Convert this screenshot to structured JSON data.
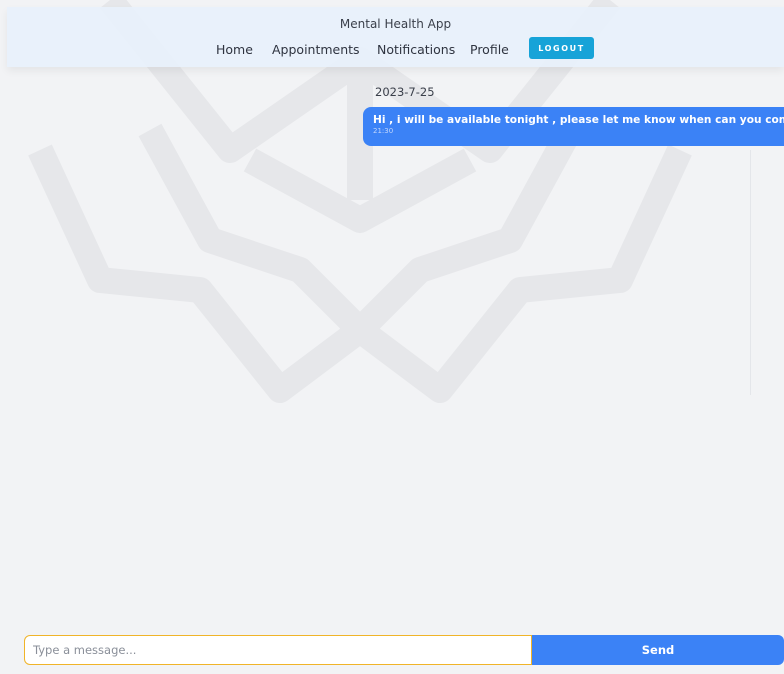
{
  "header": {
    "app_title": "Mental Health App",
    "nav": [
      "Home",
      "Appointments",
      "Notifications",
      "Profile"
    ],
    "logout_label": "LOGOUT"
  },
  "chat": {
    "date": "2023-7-25",
    "messages": [
      {
        "text": "Hi , i will be available tonight , please let me know when can you come",
        "time": "21:30"
      }
    ]
  },
  "composer": {
    "placeholder": "Type a message...",
    "value": "",
    "send_label": "Send"
  },
  "colors": {
    "accent": "#3b82f6",
    "logout": "#17a3d8",
    "input_border": "#f0b429",
    "header_bg": "#e8f1fb",
    "page_bg": "#f2f3f5"
  }
}
